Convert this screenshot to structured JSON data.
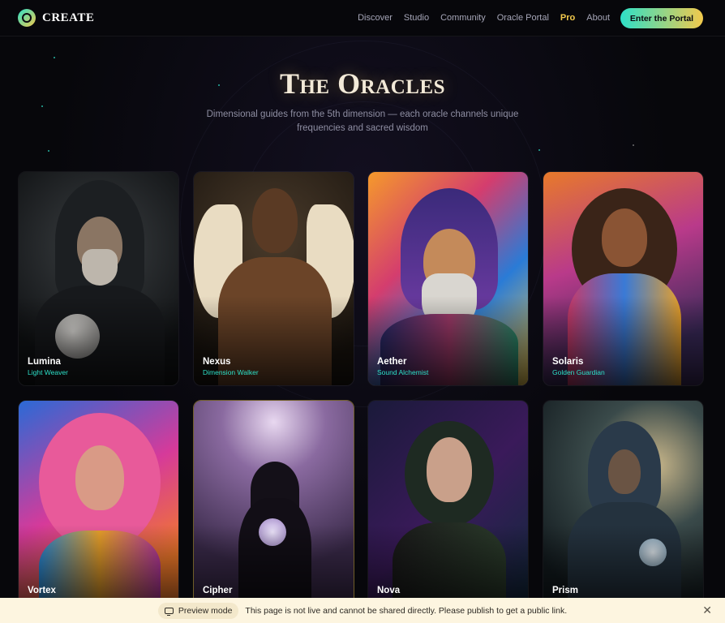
{
  "brand": {
    "name": "CREATE"
  },
  "nav": {
    "links": [
      "Discover",
      "Studio",
      "Community",
      "Oracle Portal",
      "Pro",
      "About"
    ],
    "cta": "Enter the Portal"
  },
  "hero": {
    "title": "The Oracles",
    "subtitle": "Dimensional guides from the 5th dimension — each oracle channels unique frequencies and sacred wisdom"
  },
  "oracles": [
    {
      "name": "Lumina",
      "role": "Light Weaver"
    },
    {
      "name": "Nexus",
      "role": "Dimension Walker"
    },
    {
      "name": "Aether",
      "role": "Sound Alchemist"
    },
    {
      "name": "Solaris",
      "role": "Golden Guardian"
    },
    {
      "name": "Vortex",
      "role": ""
    },
    {
      "name": "Cipher",
      "role": ""
    },
    {
      "name": "Nova",
      "role": ""
    },
    {
      "name": "Prism",
      "role": ""
    }
  ],
  "banner": {
    "mode": "Preview mode",
    "message": "This page is not live and cannot be shared directly. Please publish to get a public link."
  },
  "colors": {
    "accent_teal": "#2de0c8",
    "accent_gold": "#f2c94c",
    "background": "#07070b"
  }
}
